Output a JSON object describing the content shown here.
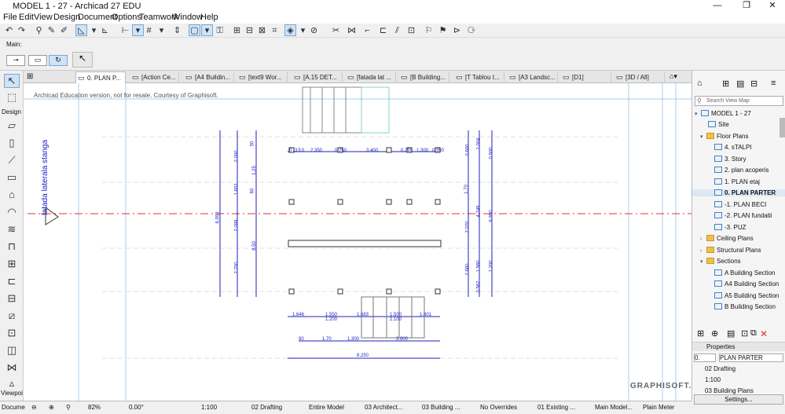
{
  "window": {
    "title": "MODEL 1 - 27 - Archicad 27 EDU",
    "controls": [
      "—",
      "❐",
      "✕"
    ]
  },
  "menu": [
    "File",
    "Edit",
    "View",
    "Design",
    "Document",
    "Options",
    "Teamwork",
    "Window",
    "Help"
  ],
  "infobox": {
    "label": "Main:"
  },
  "toolbox": {
    "design_label": "Design",
    "viewpoint_label": "Viewpoi"
  },
  "tabs": [
    {
      "label": "0. PLAN P...",
      "active": true
    },
    {
      "label": "[Action Ce..."
    },
    {
      "label": "[A4 Buildin..."
    },
    {
      "label": "[text9 Wor..."
    },
    {
      "label": "[A.15 DET..."
    },
    {
      "label": "[fatada lat ..."
    },
    {
      "label": "[B Building..."
    },
    {
      "label": "[T Tablou t..."
    },
    {
      "label": "[A3 Landsc..."
    },
    {
      "label": "[D1]"
    },
    {
      "label": "[3D / All]"
    }
  ],
  "canvas": {
    "notice": "Archicad Education version, not for resale. Courtesy of Graphisoft.",
    "section_label": "fatada laterala stanga",
    "brand": "GRAPHISOFT.",
    "dims_top": [
      "0.350",
      "2.350",
      "0.250",
      "3.400",
      "0.250",
      "1.300",
      "0.350"
    ],
    "dims_bottom1": [
      "1.646",
      "1.550",
      "1.683",
      "1.500",
      "1.601"
    ],
    "dims_bottom1b": [
      "1.200",
      "2.100"
    ],
    "dims_bottom2": [
      "90",
      "1.70",
      "1.300",
      "3.900"
    ],
    "dims_total": "8.250",
    "dims_left_outer": "6.950",
    "dims_left_mid": [
      "2.000",
      "1.652",
      "2.098",
      "2.700"
    ],
    "dims_left_inner": [
      "50",
      "1.25",
      "60",
      "8.50"
    ],
    "dims_right": [
      "0.600",
      "1.004",
      "0.500",
      "1.70",
      "2.070",
      "4.749",
      "6.950",
      "2.660",
      "1.560",
      "1.200",
      "0.567"
    ]
  },
  "statusbar": {
    "document": "Docume",
    "zoom": "82%",
    "angle": "0.00°",
    "scale": "1:100",
    "layer": "02 Drafting",
    "model": "Entire Model",
    "pen": "03 Architect...",
    "mvo": "03 Building ...",
    "overrides": "No Overrides",
    "renovation": "01 Existing ...",
    "structure": "Main Model...",
    "dimension": "Plain Meter"
  },
  "navigator": {
    "search_placeholder": "Search View Map",
    "tree": [
      {
        "label": "MODEL 1 - 27",
        "type": "root"
      },
      {
        "label": "Site",
        "type": "view"
      },
      {
        "label": "Floor Plans",
        "type": "folder"
      },
      {
        "label": "4. sTALPI",
        "type": "view"
      },
      {
        "label": "3. Story",
        "type": "view"
      },
      {
        "label": "2. plan acoperis",
        "type": "view"
      },
      {
        "label": "1. PLAN etaj",
        "type": "view"
      },
      {
        "label": "0. PLAN PARTER",
        "type": "view",
        "selected": true
      },
      {
        "label": "-1. PLAN BECI",
        "type": "view"
      },
      {
        "label": "-2. PLAN fundatii",
        "type": "view"
      },
      {
        "label": "-3. PUZ",
        "type": "view"
      },
      {
        "label": "Ceiling Plans",
        "type": "folder"
      },
      {
        "label": "Structural Plans",
        "type": "folder"
      },
      {
        "label": "Sections",
        "type": "folder"
      },
      {
        "label": "A Building Section",
        "type": "view"
      },
      {
        "label": "A4 Building Section",
        "type": "view"
      },
      {
        "label": "A5 Building Section",
        "type": "view"
      },
      {
        "label": "B Building Section",
        "type": "view"
      }
    ],
    "properties": {
      "header": "Properties",
      "id": "0.",
      "name": "PLAN PARTER",
      "layer": "02 Drafting",
      "scale": "1:100",
      "pen": "03 Building Plans",
      "settings_label": "Settings..."
    }
  }
}
